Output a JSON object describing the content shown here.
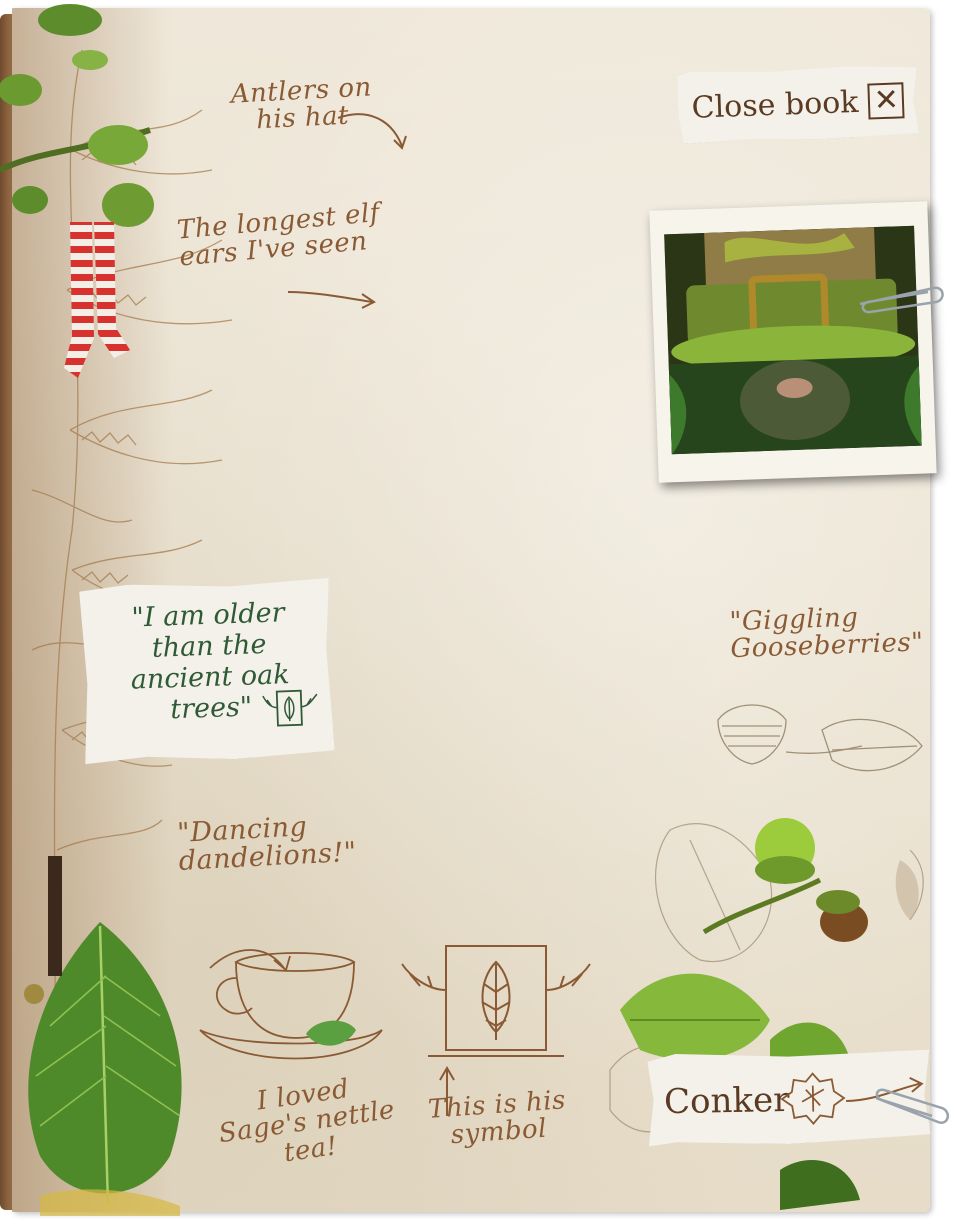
{
  "book": {
    "close_label": "Close book",
    "close_icon": "close-x-icon"
  },
  "notes": {
    "antlers": "Antlers on his hat",
    "ears": "The longest elf ears I've seen",
    "giggling": "\"Giggling Gooseberries\"",
    "dancing": "\"Dancing dandelions!\"",
    "tea": "I loved Sage's nettle tea!",
    "symbol": "This is his symbol"
  },
  "quote_card": {
    "text": "\"I am older than the ancient oak trees\"",
    "icon": "oak-leaf-symbol-icon"
  },
  "conker_button": {
    "label": "Conker",
    "icon": "conker-leaf-badge-icon",
    "arrow_icon": "arrow-right-icon"
  },
  "photo": {
    "subject": "green-hatted-elf-photo"
  },
  "colors": {
    "ink_brown": "#8a5a34",
    "ink_green": "#2f5a36",
    "paper": "#f4f1ea",
    "page": "#ebe3d2"
  }
}
